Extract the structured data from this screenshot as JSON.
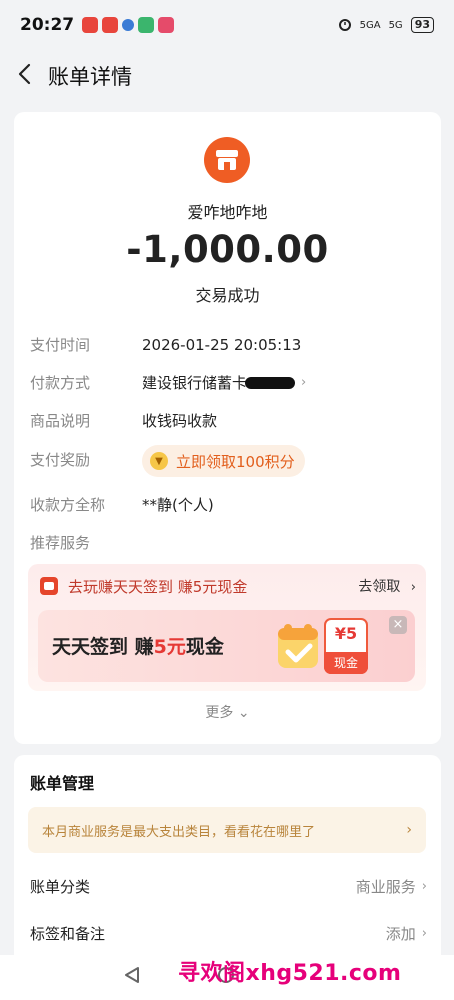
{
  "status_bar": {
    "time": "20:27",
    "signal_1": "5GA",
    "signal_2": "5G",
    "battery": "93"
  },
  "header": {
    "title": "账单详情"
  },
  "transaction": {
    "merchant_name": "爱咋地咋地",
    "amount": "-1,000.00",
    "status": "交易成功"
  },
  "details": {
    "pay_time_label": "支付时间",
    "pay_time": "2026-01-25 20:05:13",
    "pay_method_label": "付款方式",
    "pay_method": "建设银行储蓄卡",
    "goods_label": "商品说明",
    "goods": "收钱码收款",
    "reward_label": "支付奖励",
    "reward": "立即领取100积分",
    "payee_label": "收款方全称",
    "payee": "**静(个人)",
    "recommend_label": "推荐服务"
  },
  "recommend": {
    "text": "去玩赚天天签到 赚5元现金",
    "link": "去领取",
    "banner_title_a": "天天签到 赚",
    "banner_title_hl": "5元",
    "banner_title_b": "现金",
    "cash_amount": "¥5",
    "cash_label": "现金"
  },
  "more": "更多",
  "bill_management": {
    "title": "账单管理",
    "tip": "本月商业服务是最大支出类目，看看花在哪里了",
    "category_label": "账单分类",
    "category_value": "商业服务",
    "tag_label": "标签和备注",
    "tag_value": "添加"
  },
  "watermark": "寻欢阁xhg521.com",
  "colors": {
    "accent_orange": "#ef5d24",
    "reward_orange": "#e25f1d",
    "red": "#e53935",
    "watermark": "#e6007a"
  }
}
